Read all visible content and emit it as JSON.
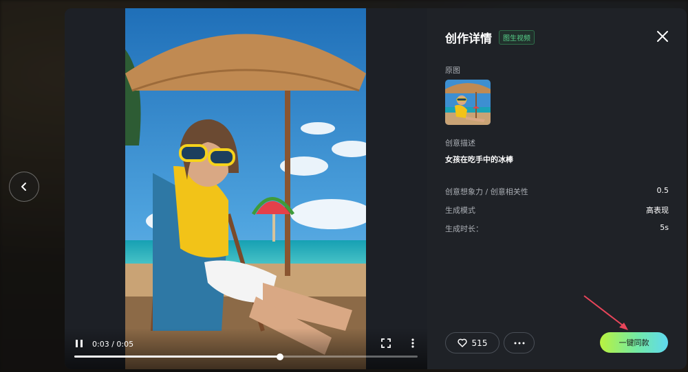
{
  "header": {
    "title": "创作详情",
    "tag": "图生视频"
  },
  "player": {
    "time": "0:03 / 0:05",
    "progress_fraction": 0.6
  },
  "details": {
    "original_label": "原图",
    "description_label": "创意描述",
    "description": "女孩在吃手中的冰棒",
    "rows": [
      {
        "label": "创意想象力 / 创意相关性",
        "value": "0.5"
      },
      {
        "label": "生成模式",
        "value": "高表现"
      },
      {
        "label": "生成时长：",
        "value": "5s"
      }
    ]
  },
  "actions": {
    "like_count": "515",
    "cta_label": "一键同款"
  },
  "icons": {
    "prev": "chevron-left-icon",
    "close": "close-icon",
    "pause": "pause-icon",
    "fullscreen": "fullscreen-icon",
    "more": "more-vertical-icon",
    "like": "heart-icon",
    "more_h": "more-horizontal-icon"
  },
  "colors": {
    "tag_green": "#57d08a",
    "cta_start": "#b9f23f",
    "cta_end": "#5fd9f0",
    "annotation_arrow": "#e8455a"
  }
}
